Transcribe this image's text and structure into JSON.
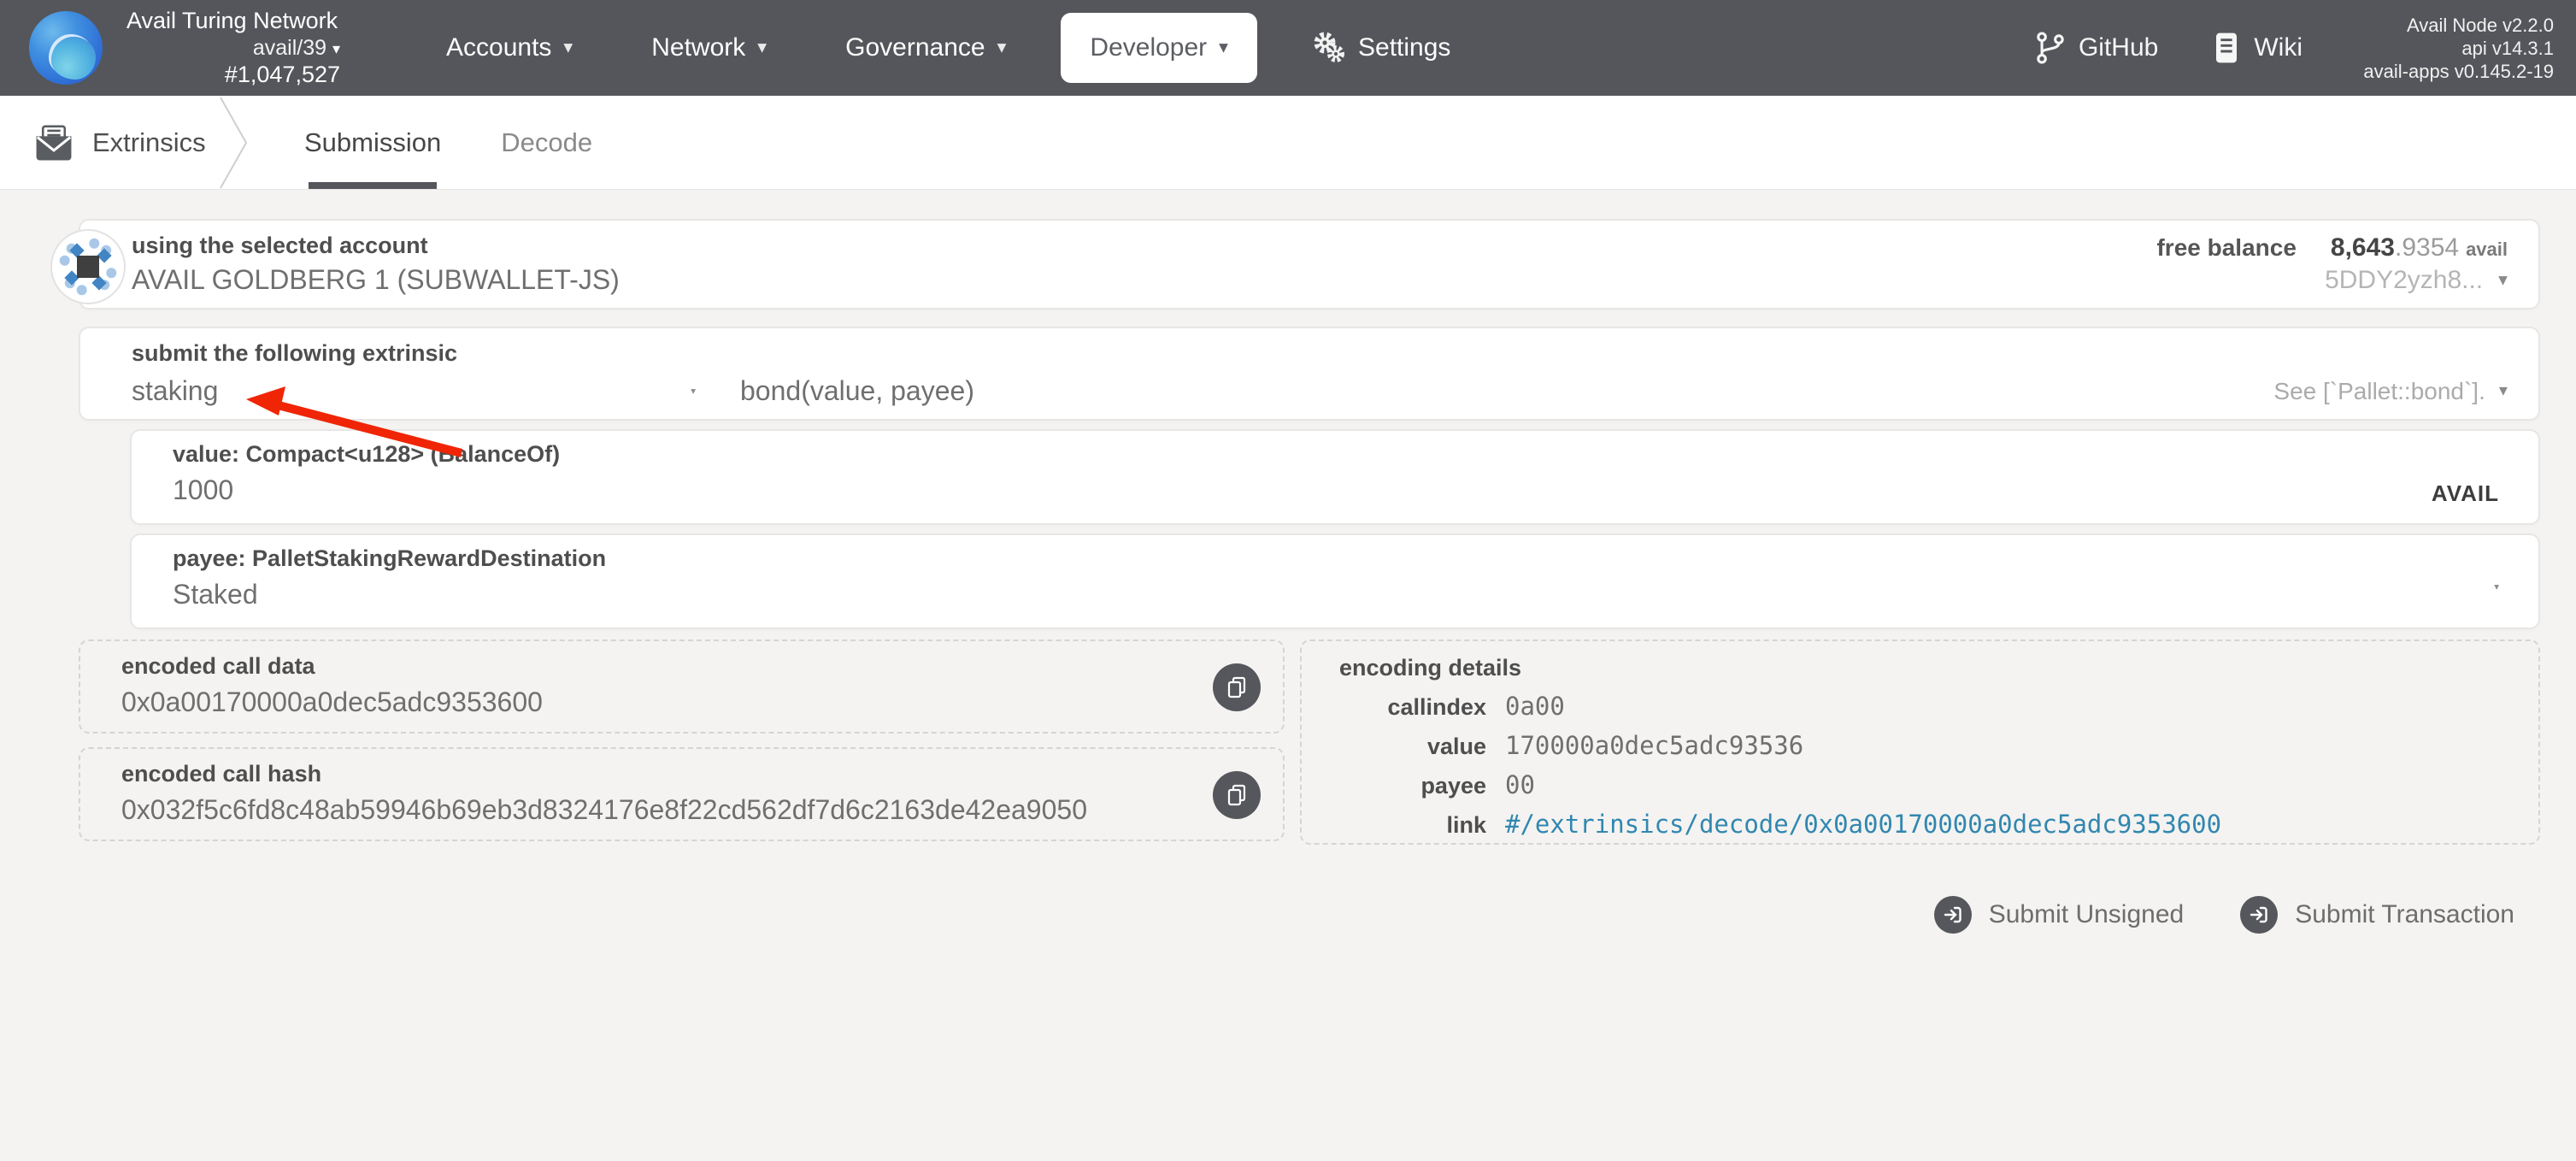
{
  "header": {
    "network_name": "Avail Turing Network",
    "chain_spec": "avail/39",
    "block_number": "#1,047,527",
    "nav": [
      {
        "label": "Accounts"
      },
      {
        "label": "Network"
      },
      {
        "label": "Governance"
      },
      {
        "label": "Developer"
      },
      {
        "label": "Settings"
      }
    ],
    "links": [
      {
        "label": "GitHub"
      },
      {
        "label": "Wiki"
      }
    ],
    "versions": {
      "node": "Avail Node v2.2.0",
      "api": "api v14.3.1",
      "apps": "avail-apps v0.145.2-19"
    }
  },
  "tabbar": {
    "section": "Extrinsics",
    "tabs": [
      {
        "label": "Submission",
        "active": true
      },
      {
        "label": "Decode",
        "active": false
      }
    ]
  },
  "account": {
    "label": "using the selected account",
    "name": "AVAIL GOLDBERG 1 (SUBWALLET-JS)",
    "free_balance_label": "free balance",
    "balance_int": "8,643",
    "balance_frac": ".9354",
    "balance_unit": "avail",
    "address": "5DDY2yzh8..."
  },
  "extrinsic": {
    "label": "submit the following extrinsic",
    "pallet": "staking",
    "method": "bond(value, payee)",
    "doc": "See [`Pallet::bond`]."
  },
  "params": {
    "value": {
      "label": "value: Compact<u128> (BalanceOf)",
      "value": "1000",
      "unit": "AVAIL"
    },
    "payee": {
      "label": "payee: PalletStakingRewardDestination",
      "value": "Staked"
    }
  },
  "encoded": {
    "data_label": "encoded call data",
    "data": "0x0a00170000a0dec5adc9353600",
    "hash_label": "encoded call hash",
    "hash": "0x032f5c6fd8c48ab59946b69eb3d8324176e8f22cd562df7d6c2163de42ea9050"
  },
  "details": {
    "title": "encoding details",
    "rows": [
      {
        "key": "callindex",
        "value": "0a00"
      },
      {
        "key": "value",
        "value": "170000a0dec5adc93536"
      },
      {
        "key": "payee",
        "value": "00"
      },
      {
        "key": "link",
        "value": "#/extrinsics/decode/0x0a00170000a0dec5adc9353600"
      }
    ]
  },
  "actions": {
    "unsigned": "Submit Unsigned",
    "signed": "Submit Transaction"
  },
  "colors": {
    "header_bg": "#54565b",
    "page_bg": "#f4f3f1",
    "link": "#3187b0",
    "arrow": "#f02506",
    "identicon_dark_blue": "#4285c4",
    "identicon_light_blue": "#a9c8e8"
  }
}
